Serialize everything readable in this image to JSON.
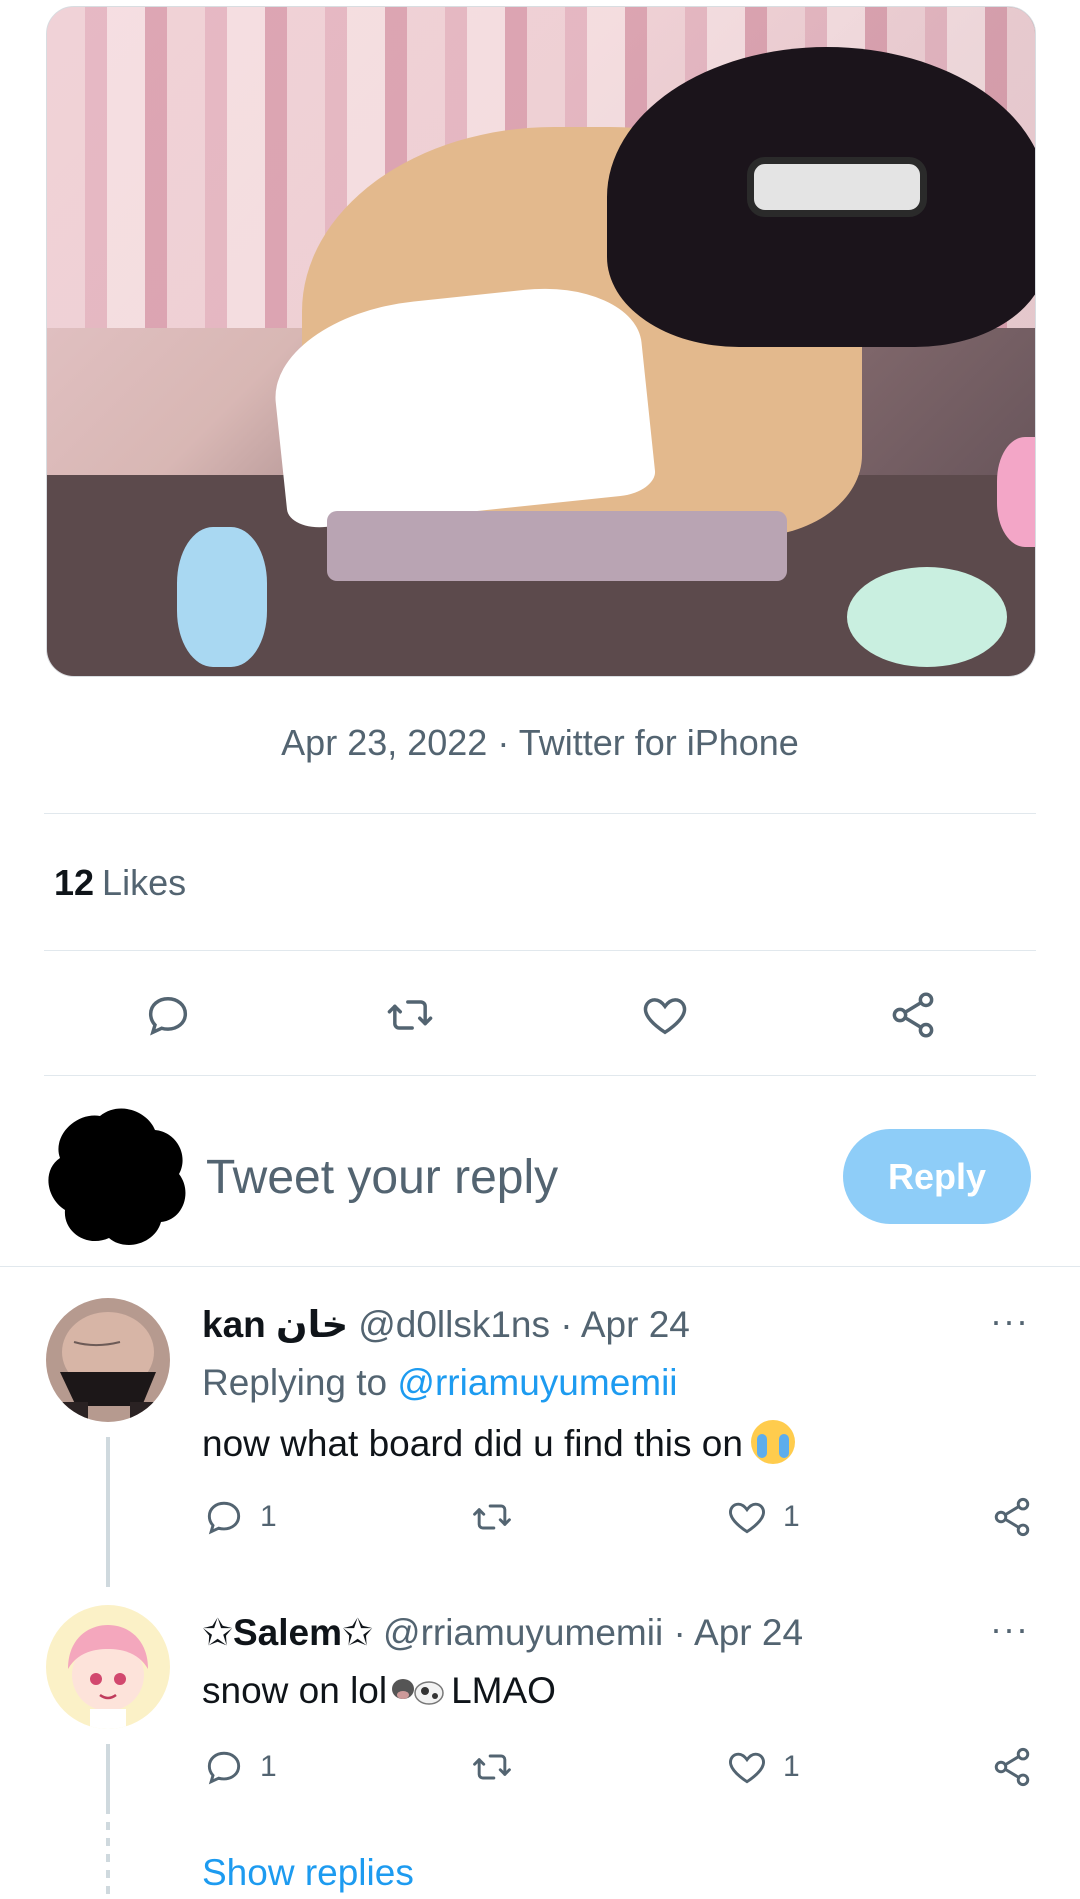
{
  "tweet": {
    "date": "Apr 23, 2022",
    "separator": "·",
    "source": "Twitter for iPhone",
    "likes_count": "12",
    "likes_label": "Likes"
  },
  "composer": {
    "placeholder": "Tweet your reply",
    "reply_button": "Reply"
  },
  "replies": [
    {
      "name": "kan خان",
      "handle": "@d0llsk1ns",
      "date": "Apr 24",
      "replying_prefix": "Replying to",
      "replying_to": "@rriamuyumemii",
      "text": "now what board did u find this on",
      "reply_count": "1",
      "like_count": "1"
    },
    {
      "name": "✩Salem✩",
      "handle": "@rriamuyumemii",
      "date": "Apr 24",
      "text_before": "snow on lol",
      "text_after": "LMAO",
      "reply_count": "1",
      "like_count": "1"
    }
  ],
  "show_replies": "Show replies",
  "more_glyph": "···",
  "icons": [
    "reply-icon",
    "retweet-icon",
    "like-icon",
    "share-icon",
    "more-icon"
  ],
  "colors": {
    "accent": "#1d9bf0",
    "reply_button_disabled": "#8ecdf8",
    "secondary_text": "#536471",
    "divider": "#e1e8ed"
  }
}
